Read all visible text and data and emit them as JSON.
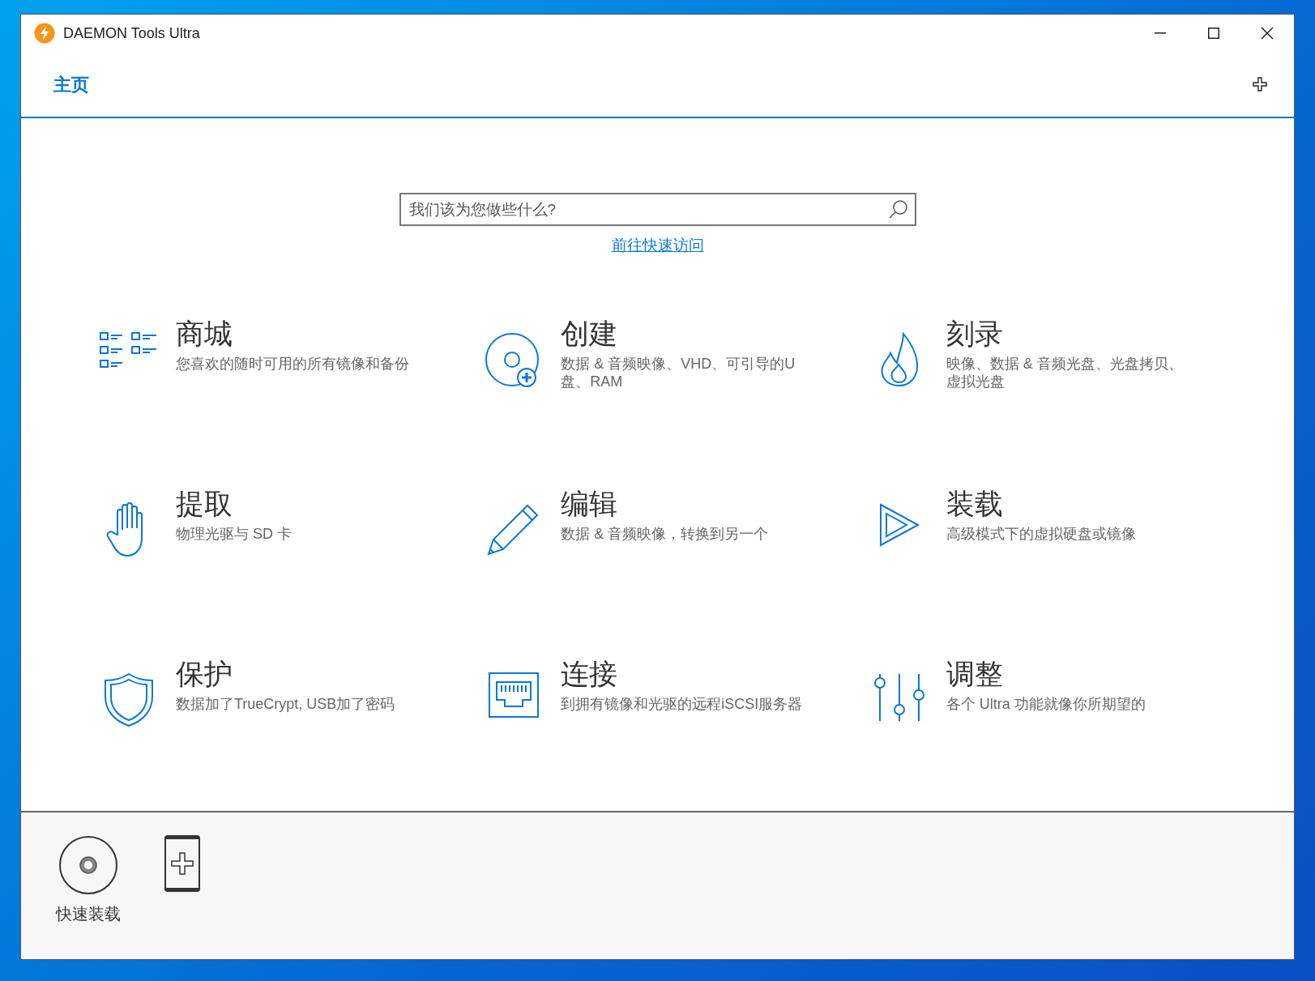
{
  "window": {
    "title": "DAEMON Tools Ultra"
  },
  "tabs": [
    {
      "label": "主页",
      "selected": true
    }
  ],
  "search": {
    "placeholder": "我们该为您做些什么?"
  },
  "quick_access_link": "前往快速访问",
  "tiles": [
    {
      "title": "商城",
      "description": "您喜欢的随时可用的所有镜像和备份"
    },
    {
      "title": "创建",
      "description": "数据 & 音频映像、VHD、可引导的U盘、RAM"
    },
    {
      "title": "刻录",
      "description": "映像、数据 & 音频光盘、光盘拷贝、虚拟光盘"
    },
    {
      "title": "提取",
      "description": "物理光驱与 SD 卡"
    },
    {
      "title": "编辑",
      "description": "数据 & 音频映像，转换到另一个"
    },
    {
      "title": "装载",
      "description": "高级模式下的虚拟硬盘或镜像"
    },
    {
      "title": "保护",
      "description": "数据加了TrueCrypt, USB加了密码"
    },
    {
      "title": "连接",
      "description": "到拥有镜像和光驱的远程iSCSI服务器"
    },
    {
      "title": "调整",
      "description": "各个 Ultra 功能就像你所期望的"
    }
  ],
  "dock": [
    {
      "kind": "disc",
      "label": "快速装载"
    },
    {
      "kind": "add-device"
    }
  ]
}
